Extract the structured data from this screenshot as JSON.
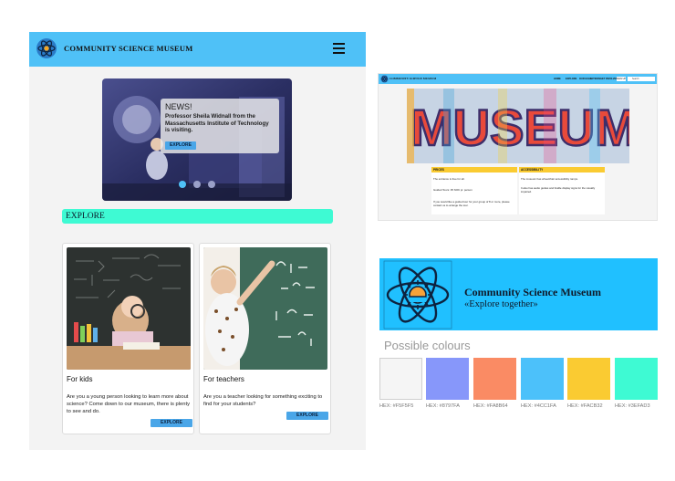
{
  "mobile": {
    "header": {
      "title": "COMMUNITY SCIENCE MUSEUM",
      "logo": "atom-logo",
      "menu_icon": "hamburger-icon"
    },
    "hero": {
      "news_heading": "NEWS!",
      "news_text": "Professor Sheila Widnall from the Massachusetts Institute of Technology is visiting.",
      "button": "EXPLORE",
      "slides": 3,
      "active_slide": 1
    },
    "section_title": "EXPLORE",
    "cards": [
      {
        "title": "For kids",
        "text": "Are you a young person looking to learn more about science? Come down to our museum, there is plenty to see and do.",
        "button": "EXPLORE"
      },
      {
        "title": "For teachers",
        "text": "Are you a teacher looking for something exciting to find for your students?",
        "button": "EXPLORE"
      }
    ]
  },
  "desktop": {
    "header": {
      "title": "COMMUNITY SCIENCE MUSEUM",
      "nav": [
        "HOME",
        "EXPLORE",
        "OUR EXHIBITIONS",
        "GET INVOLVED"
      ],
      "signup": "SIGN UP",
      "search_placeholder": "Search"
    },
    "banner_text": "MUSEUM",
    "prices": {
      "heading": "PRICES",
      "lines": [
        "The entrance is free for all.",
        "Guided Tours: 35 NOK pr. person",
        "If you would like a guided tour for your group of 8 or more, please contact us to arrange the tour."
      ]
    },
    "accessibility": {
      "heading": "ACCESSIBILITY",
      "lines": [
        "The museum has wheelchair accessibility ramps.",
        "It also has audio guides and braille display signs for the visually impaired."
      ]
    }
  },
  "brand": {
    "title": "Community Science Museum",
    "subtitle": "«Explore together»",
    "logo": "atom-sun-logo",
    "bg_color": "#20C0FF"
  },
  "palette": {
    "title": "Possible colours",
    "colors": [
      {
        "label": "HEX: #F5F5F5",
        "hex": "#F5F5F5"
      },
      {
        "label": "HEX: #8797FA",
        "hex": "#8797FA"
      },
      {
        "label": "HEX: #FA8B64",
        "hex": "#FA8B64"
      },
      {
        "label": "HEX: #4CC1FA",
        "hex": "#4CC1FA"
      },
      {
        "label": "HEX: #FACB32",
        "hex": "#FACB32"
      },
      {
        "label": "HEX: #3EFAD3",
        "hex": "#3EFAD3"
      }
    ]
  }
}
